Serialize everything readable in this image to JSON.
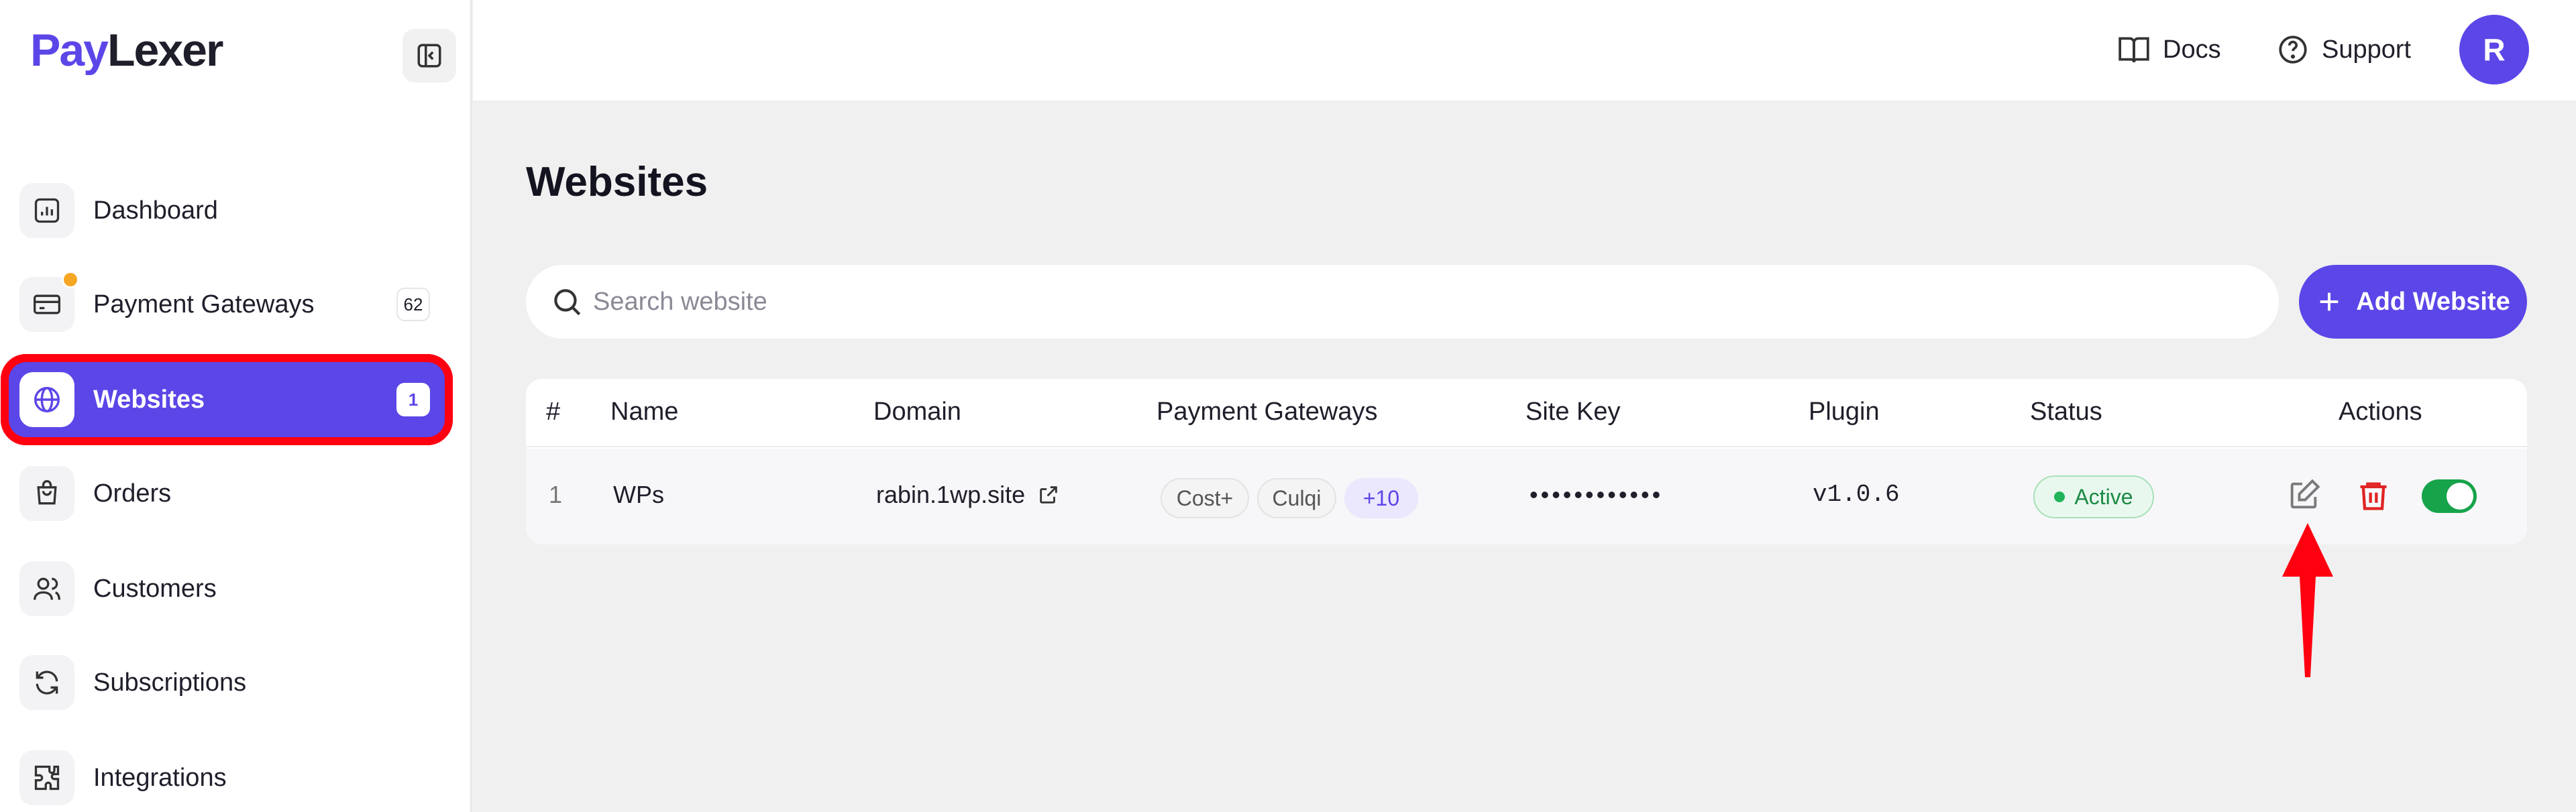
{
  "brand": {
    "part1": "Pay",
    "part2": "Lexer"
  },
  "sidebar": {
    "items": [
      {
        "label": "Dashboard",
        "icon": "chart-icon"
      },
      {
        "label": "Payment Gateways",
        "badge": "62",
        "icon": "card-icon"
      },
      {
        "label": "Websites",
        "badge": "1",
        "icon": "globe-icon"
      },
      {
        "label": "Orders",
        "icon": "bag-icon"
      },
      {
        "label": "Customers",
        "icon": "users-icon"
      },
      {
        "label": "Subscriptions",
        "icon": "refresh-icon"
      },
      {
        "label": "Integrations",
        "icon": "puzzle-icon"
      }
    ]
  },
  "header": {
    "docs": "Docs",
    "support": "Support",
    "avatar": "R"
  },
  "page": {
    "title": "Websites",
    "search_placeholder": "Search website",
    "add_button": "Add Website"
  },
  "table": {
    "columns": [
      "#",
      "Name",
      "Domain",
      "Payment Gateways",
      "Site Key",
      "Plugin",
      "Status",
      "Actions"
    ],
    "rows": [
      {
        "index": "1",
        "name": "WPs",
        "domain": "rabin.1wp.site",
        "gateways": [
          "Cost+",
          "Culqi"
        ],
        "more": "+10",
        "site_key": "••••••••••••",
        "plugin": "v1.0.6",
        "status": "Active",
        "enabled": true
      }
    ]
  },
  "colors": {
    "accent": "#5b46e8",
    "highlight": "#ff0010",
    "success": "#16a34a",
    "danger": "#e02424"
  }
}
